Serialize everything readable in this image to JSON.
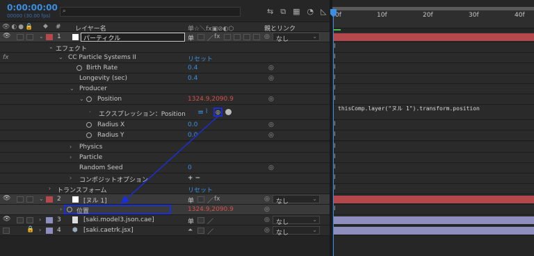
{
  "header": {
    "timecode": "0:00:00:00",
    "frame_info": "00000 (30.00 fps)",
    "search_placeholder": "",
    "col_layer_name": "レイヤー名",
    "col_num": "#",
    "col_parent": "親とリンク",
    "switches": "单☆＼fx▣⊘◐⬡"
  },
  "timeline": {
    "ruler": [
      "0f",
      "10f",
      "20f",
      "30f",
      "40f"
    ],
    "expression_text": "thisComp.layer(\"ヌル 1\").transform.position"
  },
  "rows": {
    "l1": {
      "num": "1",
      "name": "パーティクル",
      "parent": "なし"
    },
    "effect": "エフェクト",
    "cc": "CC Particle Systems II",
    "cc_reset": "リセット",
    "fx": "fx",
    "birth_rate": {
      "label": "Birth Rate",
      "value": "0.4"
    },
    "longevity": {
      "label": "Longevity (sec)",
      "value": "0.4"
    },
    "producer": "Producer",
    "position": {
      "label": "Position",
      "value": "1324.9,2090.9"
    },
    "expression": {
      "label": "エクスプレッション：Position",
      "eq": "="
    },
    "radius_x": {
      "label": "Radius X",
      "value": "0.0"
    },
    "radius_y": {
      "label": "Radius Y",
      "value": "0.0"
    },
    "physics": "Physics",
    "particle": "Particle",
    "random_seed": {
      "label": "Random Seed",
      "value": "0"
    },
    "composite": {
      "label": "コンポジットオプション",
      "value": "+ −"
    },
    "transform": {
      "label": "トランスフォーム",
      "reset": "リセット"
    },
    "l2": {
      "num": "2",
      "name": "[ヌル 1]",
      "parent": "なし"
    },
    "pos2": {
      "label": "位置",
      "value": "1324.9,2090.9"
    },
    "l3": {
      "num": "3",
      "name": "[saki.model3.json.cae]",
      "parent": "なし"
    },
    "l4": {
      "num": "4",
      "name": "[saki.caetrk.jsx]",
      "parent": "なし"
    }
  },
  "colors": {
    "accent_blue": "#3a8fe0",
    "red_value": "#d8504a",
    "layer1_bar": "#b5484c",
    "layer2_bar": "#b5484c",
    "layer34_bar": "#8f8fbf",
    "annotation": "#1a2fd8"
  }
}
